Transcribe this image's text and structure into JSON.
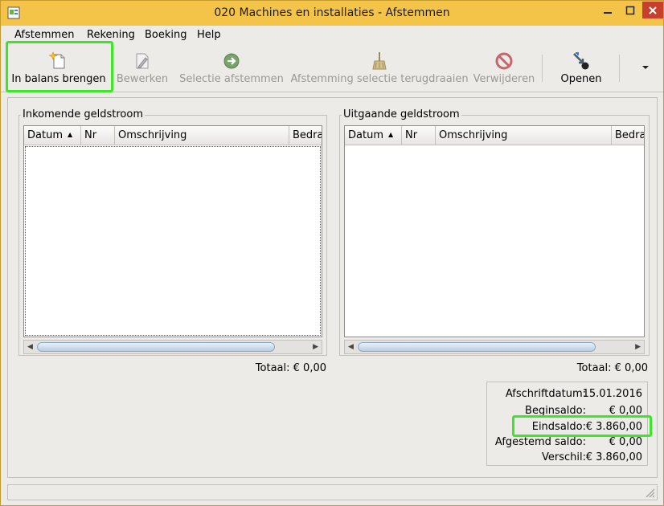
{
  "window": {
    "title": "020 Machines en installaties - Afstemmen"
  },
  "menu": [
    "Afstemmen",
    "Rekening",
    "Boeking",
    "Help"
  ],
  "toolbar": {
    "in_balans": "In balans brengen",
    "bewerken": "Bewerken",
    "selectie_afstemmen": "Selectie afstemmen",
    "afstemming_terugdraaien": "Afstemming selectie terugdraaien",
    "verwijderen": "Verwijderen",
    "openen": "Openen"
  },
  "incoming": {
    "title": "Inkomende geldstroom",
    "columns": [
      "Datum",
      "Nr",
      "Omschrijving",
      "Bedra"
    ],
    "total_label": "Totaal:",
    "total_value": "€ 0,00"
  },
  "outgoing": {
    "title": "Uitgaande geldstroom",
    "columns": [
      "Datum",
      "Nr",
      "Omschrijving",
      "Bedra"
    ],
    "total_label": "Totaal:",
    "total_value": "€ 0,00"
  },
  "summary": {
    "afschriftdatum_label": "Afschriftdatum:",
    "afschriftdatum_value": "15.01.2016",
    "beginsaldo_label": "Beginsaldo:",
    "beginsaldo_value": "€ 0,00",
    "eindsaldo_label": "Eindsaldo:",
    "eindsaldo_value": "€ 3.860,00",
    "afgestemd_label": "Afgestemd saldo:",
    "afgestemd_value": "€ 0,00",
    "verschil_label": "Verschil:",
    "verschil_value": "€ 3.860,00"
  },
  "colors": {
    "highlight": "#3ee62a",
    "titlebar": "#f3c448",
    "close": "#c7402d"
  }
}
